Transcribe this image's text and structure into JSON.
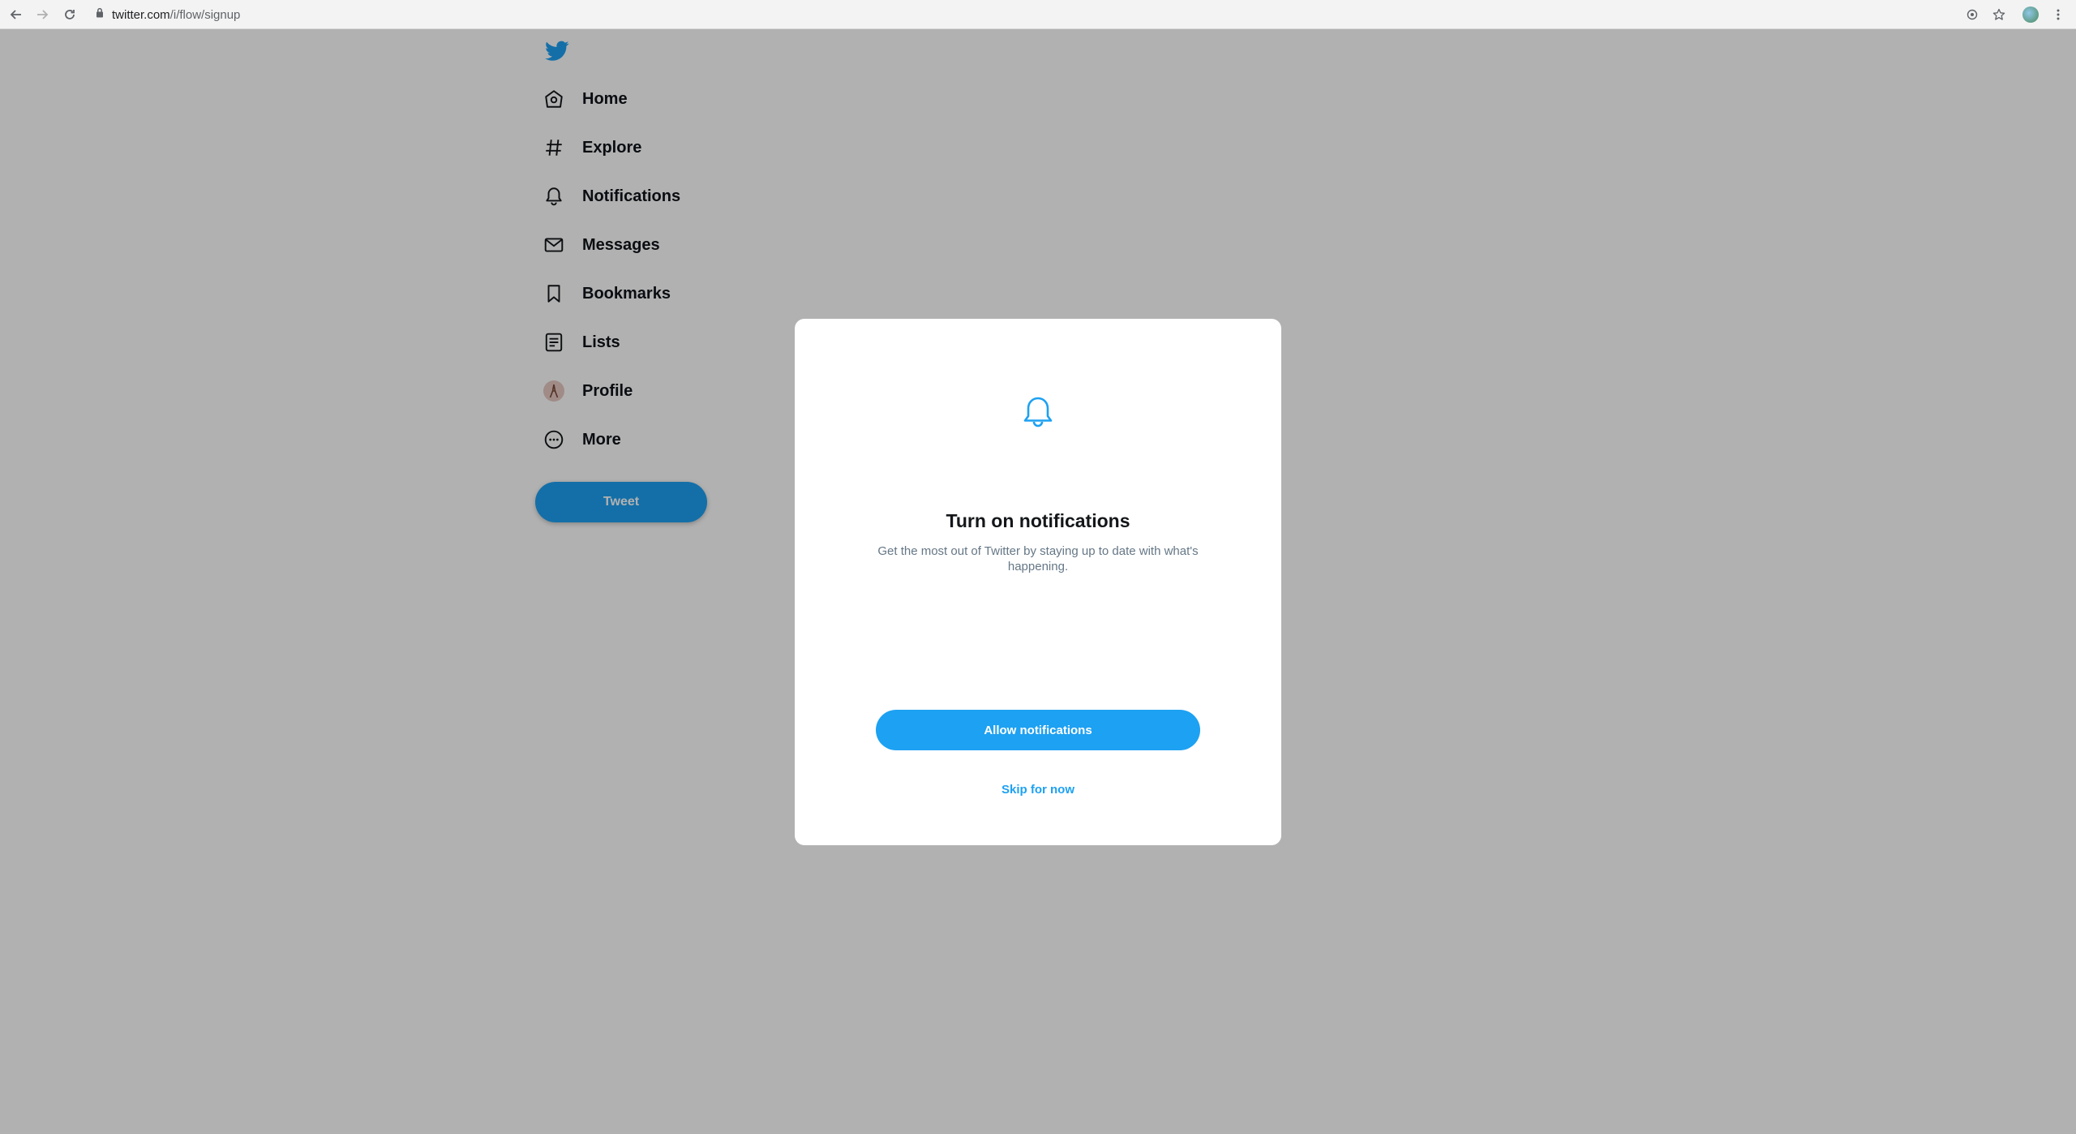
{
  "browser": {
    "url_host": "twitter.com",
    "url_path": "/i/flow/signup"
  },
  "sidebar": {
    "items": [
      {
        "label": "Home",
        "icon": "home-icon"
      },
      {
        "label": "Explore",
        "icon": "hashtag-icon"
      },
      {
        "label": "Notifications",
        "icon": "bell-icon"
      },
      {
        "label": "Messages",
        "icon": "envelope-icon"
      },
      {
        "label": "Bookmarks",
        "icon": "bookmark-icon"
      },
      {
        "label": "Lists",
        "icon": "list-icon"
      },
      {
        "label": "Profile",
        "icon": "avatar"
      },
      {
        "label": "More",
        "icon": "more-icon"
      }
    ],
    "tweet_label": "Tweet"
  },
  "modal": {
    "title": "Turn on notifications",
    "description": "Get the most out of Twitter by staying up to date with what's happening.",
    "allow_label": "Allow notifications",
    "skip_label": "Skip for now"
  },
  "colors": {
    "brand_blue": "#1da1f2",
    "overlay": "rgba(0,0,0,0.3)"
  }
}
